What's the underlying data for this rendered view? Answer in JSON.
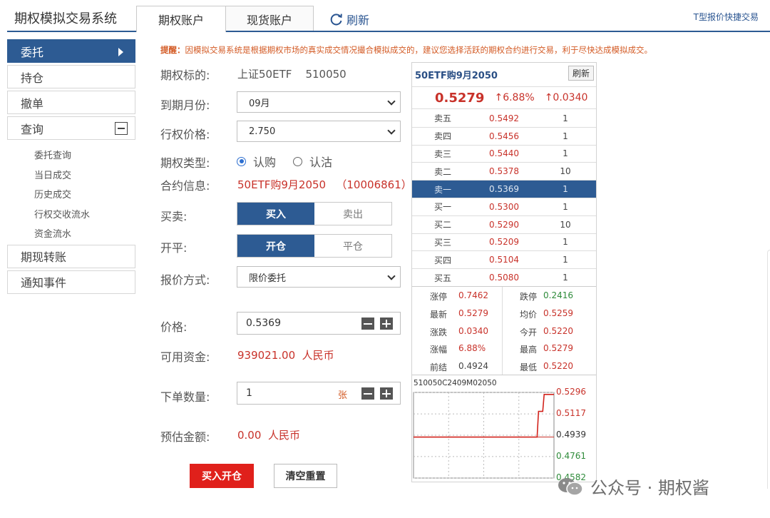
{
  "app": {
    "title": "期权模拟交易系统",
    "tabs": [
      {
        "label": "期权账户",
        "active": true
      },
      {
        "label": "现货账户",
        "active": false
      }
    ],
    "refresh_label": "刷新",
    "t_quote_label": "T型报价快捷交易"
  },
  "sidebar": {
    "items": [
      {
        "label": "委托"
      },
      {
        "label": "持仓"
      },
      {
        "label": "撤单"
      },
      {
        "label": "查询"
      }
    ],
    "sub_items": [
      {
        "label": "委托查询"
      },
      {
        "label": "当日成交"
      },
      {
        "label": "历史成交"
      },
      {
        "label": "行权交收流水"
      },
      {
        "label": "资金流水"
      }
    ],
    "bottom_items": [
      {
        "label": "期现转账"
      },
      {
        "label": "通知事件"
      }
    ]
  },
  "notice": {
    "prefix": "提醒：",
    "text": "因模拟交易系统是根据期权市场的真实成交情况撮合模拟成交的，建议您选择活跃的期权合约进行交易，利于尽快达成模拟成交。"
  },
  "form": {
    "underlying_label": "期权标的:",
    "underlying_name": "上证50ETF",
    "underlying_code": "510050",
    "expiry_label": "到期月份:",
    "expiry_value": "09月",
    "strike_label": "行权价格:",
    "strike_value": "2.750",
    "type_label": "期权类型:",
    "type_call": "认购",
    "type_put": "认沽",
    "contract_label": "合约信息:",
    "contract_name": "50ETF购9月2050",
    "contract_code": "（10006861）",
    "side_label": "买卖:",
    "side_buy": "买入",
    "side_sell": "卖出",
    "openclose_label": "开平:",
    "open_label": "开仓",
    "close_label": "平仓",
    "pricing_label": "报价方式:",
    "pricing_value": "限价委托",
    "price_label": "价格:",
    "price_value": "0.5369",
    "funds_label": "可用资金:",
    "funds_value": "939021.00",
    "funds_unit": "人民币",
    "qty_label": "下单数量:",
    "qty_value": "1",
    "qty_unit": "张",
    "est_label": "预估金额:",
    "est_value": "0.00",
    "est_unit": "人民币",
    "submit_label": "买入开仓",
    "reset_label": "清空重置"
  },
  "quote": {
    "title": "50ETF购9月2050",
    "refresh_label": "刷新",
    "last": "0.5279",
    "pct": "↑6.88%",
    "change": "↑0.0340",
    "asks": [
      {
        "name": "卖五",
        "price": "0.5492",
        "vol": "1"
      },
      {
        "name": "卖四",
        "price": "0.5456",
        "vol": "1"
      },
      {
        "name": "卖三",
        "price": "0.5440",
        "vol": "1"
      },
      {
        "name": "卖二",
        "price": "0.5378",
        "vol": "10"
      },
      {
        "name": "卖一",
        "price": "0.5369",
        "vol": "1"
      }
    ],
    "bids": [
      {
        "name": "买一",
        "price": "0.5300",
        "vol": "1"
      },
      {
        "name": "买二",
        "price": "0.5290",
        "vol": "10"
      },
      {
        "name": "买三",
        "price": "0.5209",
        "vol": "1"
      },
      {
        "name": "买四",
        "price": "0.5104",
        "vol": "1"
      },
      {
        "name": "买五",
        "price": "0.5080",
        "vol": "1"
      }
    ],
    "stats": [
      {
        "l1": "涨停",
        "v1": "0.7462",
        "c1": "#c8322a",
        "l2": "跌停",
        "v2": "0.2416",
        "c2": "#2e8b3a"
      },
      {
        "l1": "最新",
        "v1": "0.5279",
        "c1": "#c8322a",
        "l2": "均价",
        "v2": "0.5259",
        "c2": "#c8322a"
      },
      {
        "l1": "涨跌",
        "v1": "0.0340",
        "c1": "#c8322a",
        "l2": "今开",
        "v2": "0.5220",
        "c2": "#c8322a"
      },
      {
        "l1": "涨幅",
        "v1": "6.88%",
        "c1": "#c8322a",
        "l2": "最高",
        "v2": "0.5279",
        "c2": "#c8322a"
      },
      {
        "l1": "前结",
        "v1": "0.4924",
        "c1": "#444444",
        "l2": "最低",
        "v2": "0.5220",
        "c2": "#c8322a"
      }
    ],
    "mini_chart": {
      "code": "510050C2409M02050",
      "y_labels": [
        {
          "value": "0.5296",
          "color": "#c8322a"
        },
        {
          "value": "0.5117",
          "color": "#c8322a"
        },
        {
          "value": "0.4939",
          "color": "#333333"
        },
        {
          "value": "0.4761",
          "color": "#2e8b3a"
        },
        {
          "value": "0.4582",
          "color": "#2e8b3a"
        }
      ],
      "ylim": [
        0.4582,
        0.5296
      ],
      "baseline": 0.4924,
      "series": [
        {
          "t": 0.0,
          "v": 0.4924
        },
        {
          "t": 0.88,
          "v": 0.4924
        },
        {
          "t": 0.89,
          "v": 0.5138
        },
        {
          "t": 0.92,
          "v": 0.5138
        },
        {
          "t": 0.93,
          "v": 0.5279
        },
        {
          "t": 1.0,
          "v": 0.5279
        }
      ]
    }
  },
  "watermark": {
    "text": "公众号 · 期权酱"
  }
}
